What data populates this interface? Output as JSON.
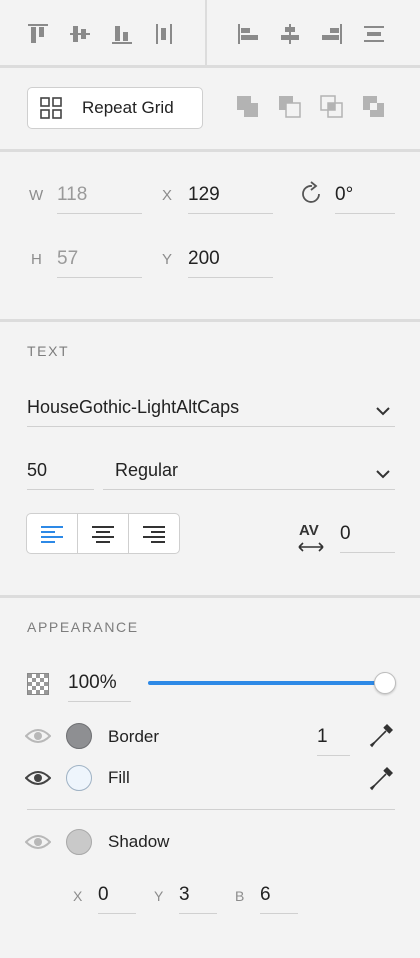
{
  "toolbar": {
    "align_icons": [
      "align-top-icon",
      "align-middle-icon",
      "align-bottom-icon",
      "distribute-vertical-icon"
    ],
    "distribute_icons": [
      "align-left-icon",
      "align-center-icon",
      "align-right-icon",
      "distribute-horizontal-icon"
    ]
  },
  "repeat_grid": {
    "label": "Repeat Grid",
    "boolean_icons": [
      "add-icon",
      "subtract-icon",
      "intersect-icon",
      "exclude-icon"
    ]
  },
  "transform": {
    "w_label": "W",
    "w_value": "118",
    "x_label": "X",
    "x_value": "129",
    "h_label": "H",
    "h_value": "57",
    "y_label": "Y",
    "y_value": "200",
    "rotation_value": "0°"
  },
  "text": {
    "section_title": "TEXT",
    "font_family": "HouseGothic-LightAltCaps",
    "font_size": "50",
    "font_weight": "Regular",
    "alignment_selected": "left",
    "tracking_label": "AV",
    "tracking_value": "0"
  },
  "appearance": {
    "section_title": "APPEARANCE",
    "opacity": "100%",
    "opacity_fraction": 1.0,
    "border_label": "Border",
    "border_width": "1",
    "border_color": "#8e8f92",
    "fill_label": "Fill",
    "fill_color": "#eef5fc",
    "shadow_label": "Shadow",
    "shadow_color": "#c9c9c9",
    "shadow_x_label": "X",
    "shadow_x": "0",
    "shadow_y_label": "Y",
    "shadow_y": "3",
    "shadow_b_label": "B",
    "shadow_b": "6"
  },
  "colors": {
    "accent": "#2d89e6",
    "icon": "#8a8a8a",
    "panel_bg": "#f3f3f3"
  }
}
